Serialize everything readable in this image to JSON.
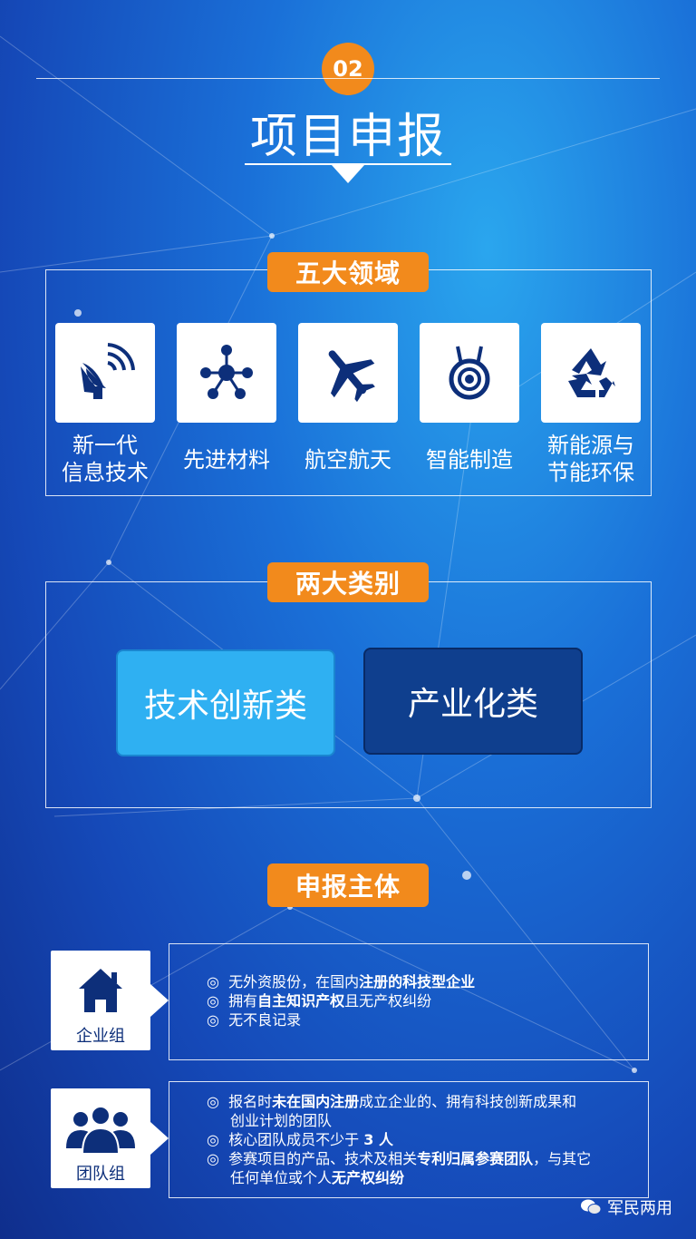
{
  "header": {
    "number": "02",
    "title": "项目申报"
  },
  "five_fields": {
    "badge": "五大领域",
    "items": [
      {
        "label": [
          "新一代",
          "信息技术"
        ],
        "icon": "satellite-dish-icon"
      },
      {
        "label": [
          "先进材料"
        ],
        "icon": "molecule-icon"
      },
      {
        "label": [
          "航空航天"
        ],
        "icon": "airplane-icon"
      },
      {
        "label": [
          "智能制造"
        ],
        "icon": "robot-icon"
      },
      {
        "label": [
          "新能源与",
          "节能环保"
        ],
        "icon": "recycle-icon"
      }
    ]
  },
  "two_categories": {
    "badge": "两大类别",
    "items": [
      {
        "label": "技术创新类",
        "color": "#2fb0f2"
      },
      {
        "label": "产业化类",
        "color": "#0f3f8e"
      }
    ]
  },
  "applicants": {
    "badge": "申报主体",
    "enterprise": {
      "label": "企业组",
      "icon": "house-icon",
      "lines": [
        {
          "bullet": "◎",
          "parts": [
            {
              "t": "无外资股份，在国内",
              "b": false
            },
            {
              "t": "注册的科技型企业",
              "b": true
            }
          ]
        },
        {
          "bullet": "◎",
          "parts": [
            {
              "t": "拥有",
              "b": false
            },
            {
              "t": "自主知识产权",
              "b": true
            },
            {
              "t": "且无产权纠纷",
              "b": false
            }
          ]
        },
        {
          "bullet": "◎",
          "parts": [
            {
              "t": "无不良记录",
              "b": false
            }
          ]
        }
      ]
    },
    "team": {
      "label": "团队组",
      "icon": "team-people-icon",
      "lines": [
        {
          "bullet": "◎",
          "parts": [
            {
              "t": "报名时",
              "b": false
            },
            {
              "t": "未在国内注册",
              "b": true
            },
            {
              "t": "成立企业的、拥有科技创新成果和",
              "b": false
            }
          ]
        },
        {
          "bullet": "",
          "parts": [
            {
              "t": "创业计划的团队",
              "b": false
            }
          ]
        },
        {
          "bullet": "◎",
          "parts": [
            {
              "t": "核心团队成员不少于 ",
              "b": false
            },
            {
              "t": "3 人",
              "b": true
            }
          ]
        },
        {
          "bullet": "◎",
          "parts": [
            {
              "t": "参赛项目的产品、技术及相关",
              "b": false
            },
            {
              "t": "专利归属参赛团队",
              "b": true
            },
            {
              "t": "，与其它",
              "b": false
            }
          ]
        },
        {
          "bullet": "",
          "parts": [
            {
              "t": "任何单位或个人",
              "b": false
            },
            {
              "t": "无产权纠纷",
              "b": true
            }
          ]
        }
      ]
    }
  },
  "watermark": {
    "text": "军民两用",
    "icon": "wechat-icon"
  },
  "colors": {
    "accent": "#f28a1c",
    "navy": "#0d2f7a"
  }
}
